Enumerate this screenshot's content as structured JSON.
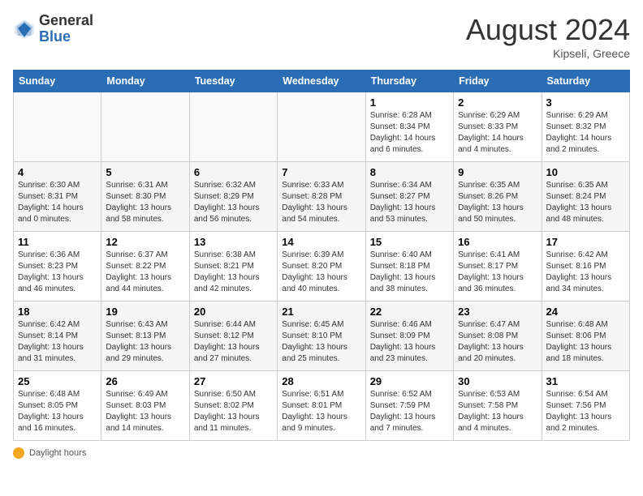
{
  "header": {
    "logo_general": "General",
    "logo_blue": "Blue",
    "month_year": "August 2024",
    "location": "Kipseli, Greece"
  },
  "days_of_week": [
    "Sunday",
    "Monday",
    "Tuesday",
    "Wednesday",
    "Thursday",
    "Friday",
    "Saturday"
  ],
  "weeks": [
    [
      {
        "day": "",
        "info": ""
      },
      {
        "day": "",
        "info": ""
      },
      {
        "day": "",
        "info": ""
      },
      {
        "day": "",
        "info": ""
      },
      {
        "day": "1",
        "info": "Sunrise: 6:28 AM\nSunset: 8:34 PM\nDaylight: 14 hours\nand 6 minutes."
      },
      {
        "day": "2",
        "info": "Sunrise: 6:29 AM\nSunset: 8:33 PM\nDaylight: 14 hours\nand 4 minutes."
      },
      {
        "day": "3",
        "info": "Sunrise: 6:29 AM\nSunset: 8:32 PM\nDaylight: 14 hours\nand 2 minutes."
      }
    ],
    [
      {
        "day": "4",
        "info": "Sunrise: 6:30 AM\nSunset: 8:31 PM\nDaylight: 14 hours\nand 0 minutes."
      },
      {
        "day": "5",
        "info": "Sunrise: 6:31 AM\nSunset: 8:30 PM\nDaylight: 13 hours\nand 58 minutes."
      },
      {
        "day": "6",
        "info": "Sunrise: 6:32 AM\nSunset: 8:29 PM\nDaylight: 13 hours\nand 56 minutes."
      },
      {
        "day": "7",
        "info": "Sunrise: 6:33 AM\nSunset: 8:28 PM\nDaylight: 13 hours\nand 54 minutes."
      },
      {
        "day": "8",
        "info": "Sunrise: 6:34 AM\nSunset: 8:27 PM\nDaylight: 13 hours\nand 53 minutes."
      },
      {
        "day": "9",
        "info": "Sunrise: 6:35 AM\nSunset: 8:26 PM\nDaylight: 13 hours\nand 50 minutes."
      },
      {
        "day": "10",
        "info": "Sunrise: 6:35 AM\nSunset: 8:24 PM\nDaylight: 13 hours\nand 48 minutes."
      }
    ],
    [
      {
        "day": "11",
        "info": "Sunrise: 6:36 AM\nSunset: 8:23 PM\nDaylight: 13 hours\nand 46 minutes."
      },
      {
        "day": "12",
        "info": "Sunrise: 6:37 AM\nSunset: 8:22 PM\nDaylight: 13 hours\nand 44 minutes."
      },
      {
        "day": "13",
        "info": "Sunrise: 6:38 AM\nSunset: 8:21 PM\nDaylight: 13 hours\nand 42 minutes."
      },
      {
        "day": "14",
        "info": "Sunrise: 6:39 AM\nSunset: 8:20 PM\nDaylight: 13 hours\nand 40 minutes."
      },
      {
        "day": "15",
        "info": "Sunrise: 6:40 AM\nSunset: 8:18 PM\nDaylight: 13 hours\nand 38 minutes."
      },
      {
        "day": "16",
        "info": "Sunrise: 6:41 AM\nSunset: 8:17 PM\nDaylight: 13 hours\nand 36 minutes."
      },
      {
        "day": "17",
        "info": "Sunrise: 6:42 AM\nSunset: 8:16 PM\nDaylight: 13 hours\nand 34 minutes."
      }
    ],
    [
      {
        "day": "18",
        "info": "Sunrise: 6:42 AM\nSunset: 8:14 PM\nDaylight: 13 hours\nand 31 minutes."
      },
      {
        "day": "19",
        "info": "Sunrise: 6:43 AM\nSunset: 8:13 PM\nDaylight: 13 hours\nand 29 minutes."
      },
      {
        "day": "20",
        "info": "Sunrise: 6:44 AM\nSunset: 8:12 PM\nDaylight: 13 hours\nand 27 minutes."
      },
      {
        "day": "21",
        "info": "Sunrise: 6:45 AM\nSunset: 8:10 PM\nDaylight: 13 hours\nand 25 minutes."
      },
      {
        "day": "22",
        "info": "Sunrise: 6:46 AM\nSunset: 8:09 PM\nDaylight: 13 hours\nand 23 minutes."
      },
      {
        "day": "23",
        "info": "Sunrise: 6:47 AM\nSunset: 8:08 PM\nDaylight: 13 hours\nand 20 minutes."
      },
      {
        "day": "24",
        "info": "Sunrise: 6:48 AM\nSunset: 8:06 PM\nDaylight: 13 hours\nand 18 minutes."
      }
    ],
    [
      {
        "day": "25",
        "info": "Sunrise: 6:48 AM\nSunset: 8:05 PM\nDaylight: 13 hours\nand 16 minutes."
      },
      {
        "day": "26",
        "info": "Sunrise: 6:49 AM\nSunset: 8:03 PM\nDaylight: 13 hours\nand 14 minutes."
      },
      {
        "day": "27",
        "info": "Sunrise: 6:50 AM\nSunset: 8:02 PM\nDaylight: 13 hours\nand 11 minutes."
      },
      {
        "day": "28",
        "info": "Sunrise: 6:51 AM\nSunset: 8:01 PM\nDaylight: 13 hours\nand 9 minutes."
      },
      {
        "day": "29",
        "info": "Sunrise: 6:52 AM\nSunset: 7:59 PM\nDaylight: 13 hours\nand 7 minutes."
      },
      {
        "day": "30",
        "info": "Sunrise: 6:53 AM\nSunset: 7:58 PM\nDaylight: 13 hours\nand 4 minutes."
      },
      {
        "day": "31",
        "info": "Sunrise: 6:54 AM\nSunset: 7:56 PM\nDaylight: 13 hours\nand 2 minutes."
      }
    ]
  ],
  "footer": {
    "daylight_note": "Daylight hours"
  }
}
